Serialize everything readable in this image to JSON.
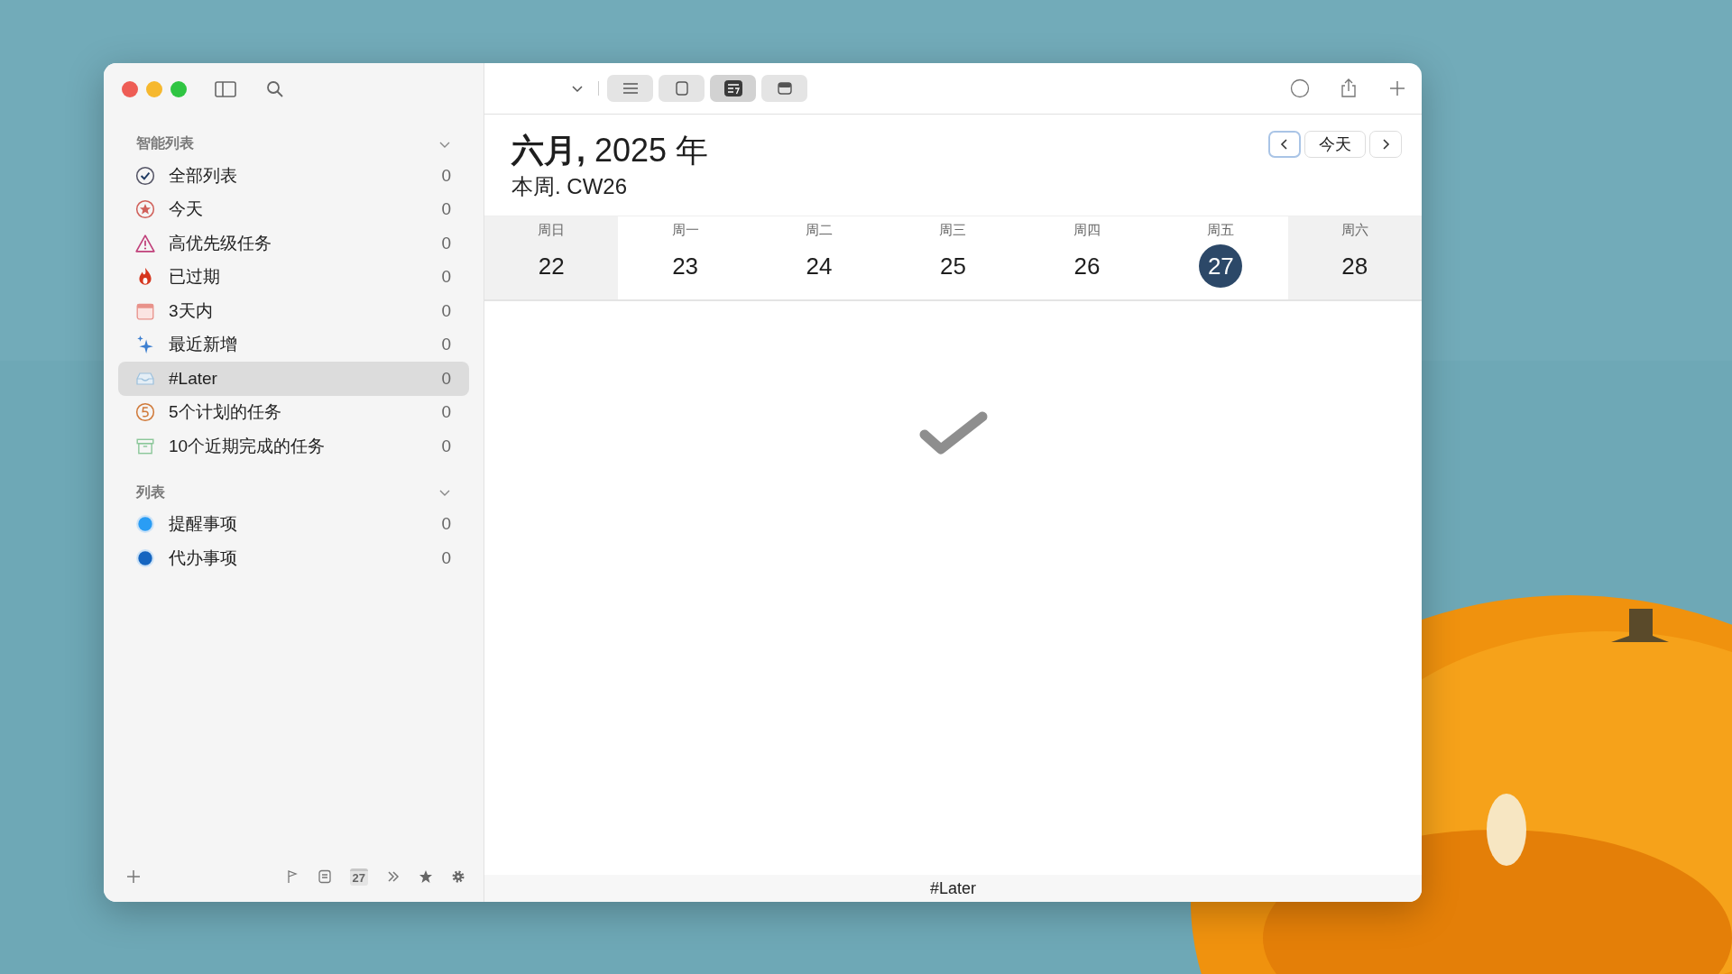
{
  "sidebar": {
    "sections": [
      {
        "title": "智能列表",
        "expanded": true,
        "items": [
          {
            "kind": "check",
            "label": "全部列表",
            "count": "0",
            "selected": false
          },
          {
            "kind": "star",
            "label": "今天",
            "count": "0",
            "selected": false
          },
          {
            "kind": "warning",
            "label": "高优先级任务",
            "count": "0",
            "selected": false
          },
          {
            "kind": "flame",
            "label": "已过期",
            "count": "0",
            "selected": false
          },
          {
            "kind": "calendar",
            "label": "3天内",
            "count": "0",
            "selected": false
          },
          {
            "kind": "sparkle",
            "label": "最近新增",
            "count": "0",
            "selected": false
          },
          {
            "kind": "inbox",
            "label": "#Later",
            "count": "0",
            "selected": true
          },
          {
            "kind": "five",
            "label": "5个计划的任务",
            "count": "0",
            "selected": false
          },
          {
            "kind": "archive",
            "label": "10个近期完成的任务",
            "count": "0",
            "selected": false
          }
        ]
      },
      {
        "title": "列表",
        "expanded": true,
        "items": [
          {
            "kind": "dot",
            "color": "#2a9df4",
            "label": "提醒事项",
            "count": "0",
            "selected": false
          },
          {
            "kind": "dot",
            "color": "#1565c0",
            "label": "代办事项",
            "count": "0",
            "selected": false
          }
        ]
      }
    ],
    "calendar_badge": "27"
  },
  "toolbar": {
    "views": [
      {
        "kind": "list",
        "selected": false
      },
      {
        "kind": "square",
        "selected": false
      },
      {
        "kind": "week",
        "selected": true
      },
      {
        "kind": "card",
        "selected": false
      }
    ]
  },
  "header": {
    "title": "**六月,** 2025 年",
    "subtitle": "本周. CW26",
    "today_button": "今天"
  },
  "week": [
    {
      "weekday": "周日",
      "day": "22",
      "weekend": true,
      "selected": false
    },
    {
      "weekday": "周一",
      "day": "23",
      "weekend": false,
      "selected": false
    },
    {
      "weekday": "周二",
      "day": "24",
      "weekend": false,
      "selected": false
    },
    {
      "weekday": "周三",
      "day": "25",
      "weekend": false,
      "selected": false
    },
    {
      "weekday": "周四",
      "day": "26",
      "weekend": false,
      "selected": false
    },
    {
      "weekday": "周五",
      "day": "27",
      "weekend": false,
      "selected": true
    },
    {
      "weekday": "周六",
      "day": "28",
      "weekend": true,
      "selected": false
    }
  ],
  "status_bar": "#Later"
}
